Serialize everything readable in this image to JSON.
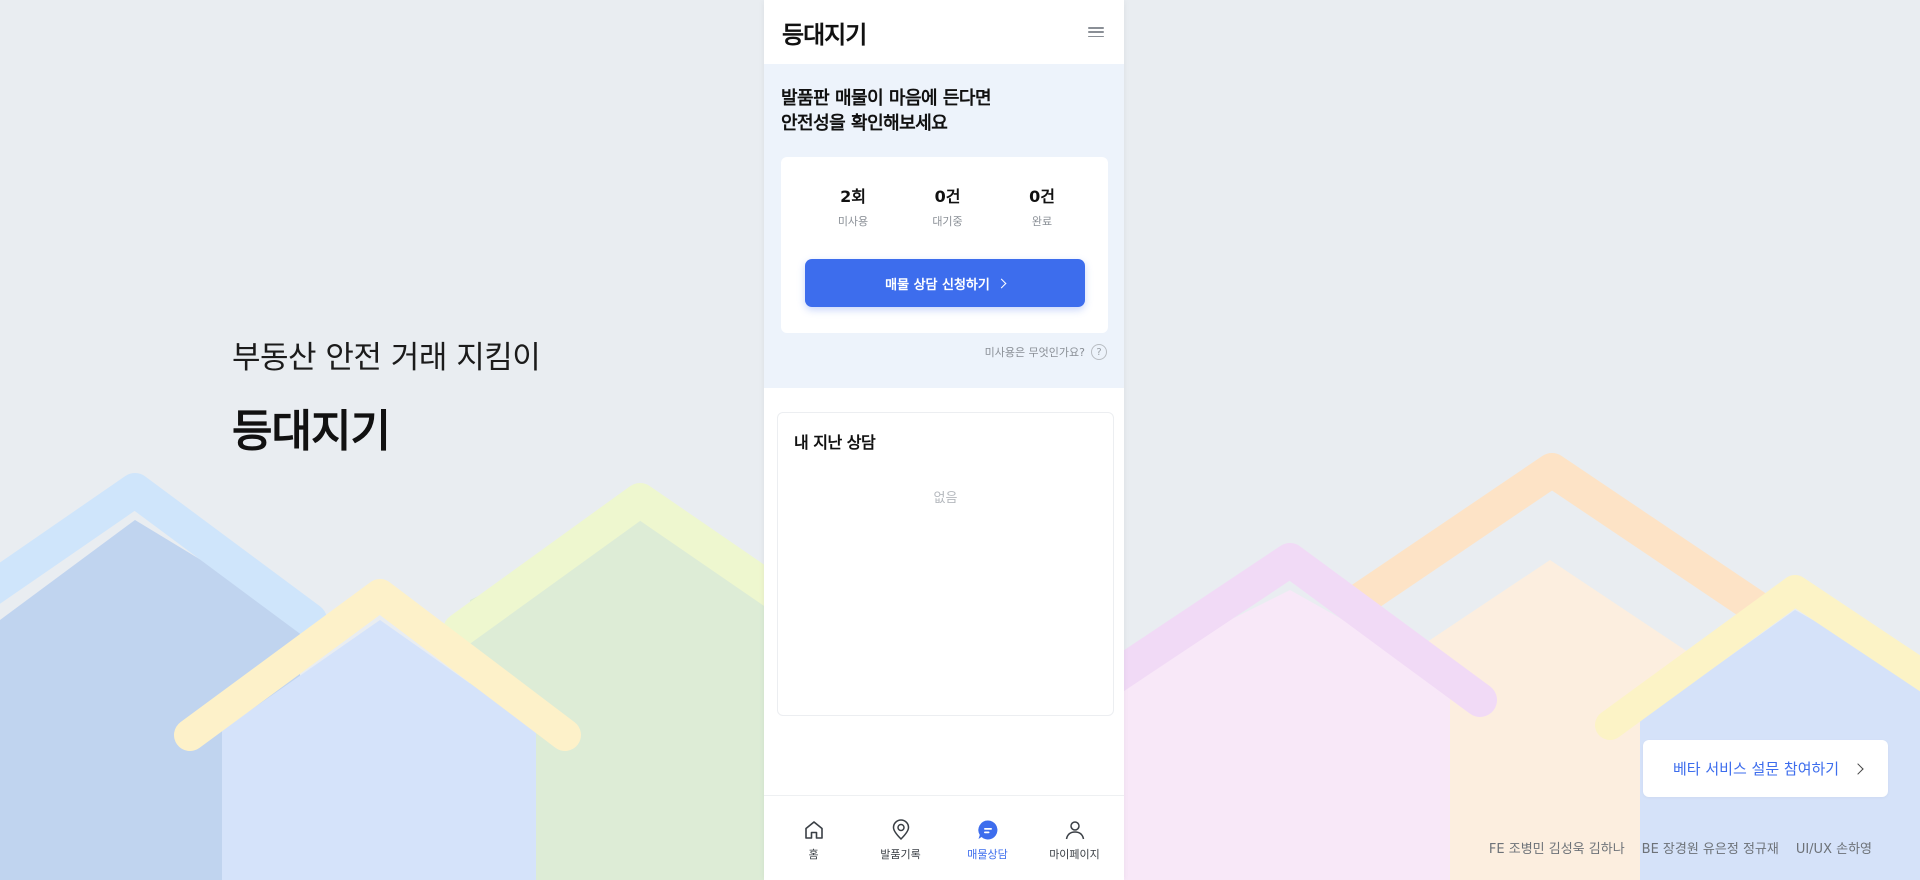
{
  "intro": {
    "tagline": "부동산 안전 거래 지킴이",
    "brand": "등대지기"
  },
  "app": {
    "logo": "등대지기",
    "menu_icon": "hamburger-menu-icon"
  },
  "hero": {
    "title_line1": "발품판 매물이 마음에 든다면",
    "title_line2": "안전성을 확인해보세요"
  },
  "stats": [
    {
      "value": "2회",
      "label": "미사용"
    },
    {
      "value": "0건",
      "label": "대기중"
    },
    {
      "value": "0건",
      "label": "완료"
    }
  ],
  "cta": {
    "label": "매물 상담 신청하기"
  },
  "help": {
    "text": "미사용은 무엇인가요?",
    "icon_glyph": "?"
  },
  "history": {
    "title": "내 지난 상담",
    "empty": "없음"
  },
  "tabs": [
    {
      "label": "홈",
      "icon": "home-icon",
      "active": false
    },
    {
      "label": "발품기록",
      "icon": "location-pin-icon",
      "active": false
    },
    {
      "label": "매물상담",
      "icon": "chat-bubble-icon",
      "active": true
    },
    {
      "label": "마이페이지",
      "icon": "user-icon",
      "active": false
    }
  ],
  "survey": {
    "label": "베타 서비스 설문 참여하기"
  },
  "credits": [
    "FE 조병민 김성욱 김하나",
    "BE 장경원 유은정 정규재",
    "UI/UX 손하영"
  ],
  "colors": {
    "accent": "#3d6ded",
    "background": "#e9edf1",
    "hero_bg": "#edf3fb"
  }
}
